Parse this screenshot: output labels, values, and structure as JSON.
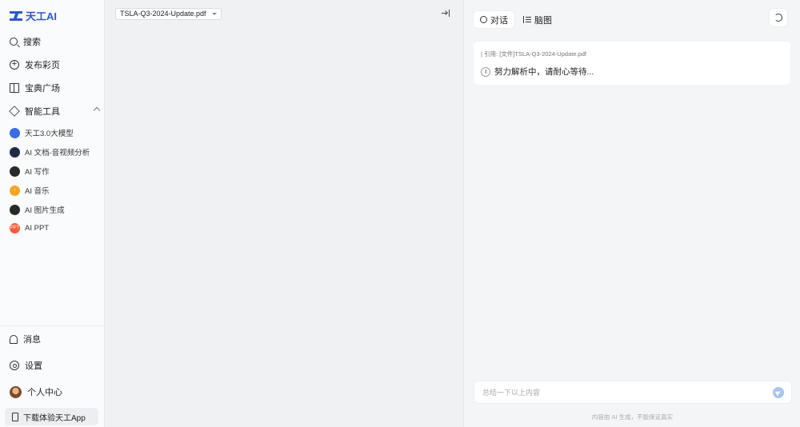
{
  "brand": {
    "name": "天工AI",
    "color": "#2d57d8"
  },
  "sidebar": {
    "main_items": [
      {
        "label": "搜索",
        "icon": "search-icon"
      },
      {
        "label": "发布彩页",
        "icon": "plus-circle-icon"
      },
      {
        "label": "宝典广场",
        "icon": "book-icon"
      },
      {
        "label": "智能工具",
        "icon": "cube-icon"
      }
    ],
    "tools": [
      {
        "label": "天工3.0大模型",
        "icon": "tiangong-model-icon"
      },
      {
        "label": "AI 文档-音视频分析",
        "icon": "doc-analysis-icon"
      },
      {
        "label": "AI 写作",
        "icon": "writing-icon"
      },
      {
        "label": "AI 音乐",
        "icon": "music-icon",
        "glyph": "♪"
      },
      {
        "label": "AI 图片生成",
        "icon": "image-gen-icon"
      },
      {
        "label": "AI PPT",
        "icon": "ppt-icon",
        "glyph": "PPT"
      }
    ],
    "bottom_items": [
      {
        "label": "消息",
        "icon": "bell-icon"
      },
      {
        "label": "设置",
        "icon": "gear-icon"
      },
      {
        "label": "个人中心",
        "icon": "avatar"
      }
    ],
    "download_app": "下载体验天工App"
  },
  "viewer": {
    "document_name": "TSLA-Q3-2024-Update.pdf"
  },
  "chat": {
    "tabs": [
      {
        "label": "对话",
        "icon": "chat-icon",
        "active": true
      },
      {
        "label": "脑图",
        "icon": "mindmap-icon",
        "active": false
      }
    ],
    "message": {
      "quote": "| 引用: [文件]TSLA-Q3-2024-Update.pdf",
      "status": "努力解析中，请耐心等待..."
    },
    "input": {
      "placeholder": "总结一下以上内容",
      "value": ""
    },
    "disclaimer": "内容由 AI 生成，不能保证真实"
  }
}
